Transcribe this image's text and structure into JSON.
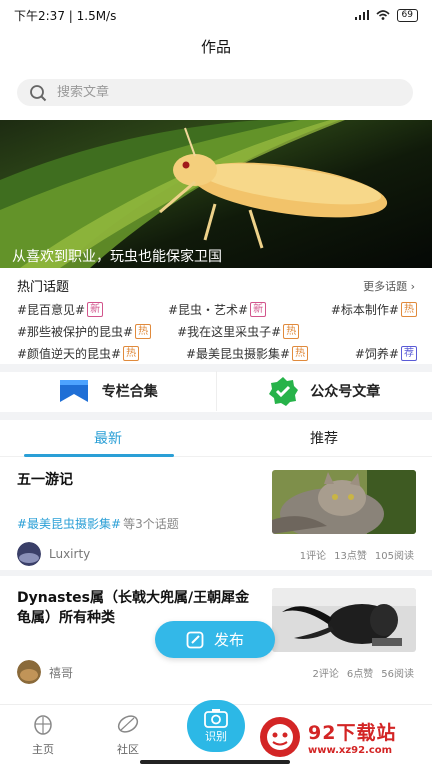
{
  "status": {
    "time_speed": "下午2:37 | 1.5M/s",
    "battery": "69"
  },
  "header": {
    "title": "作品"
  },
  "search": {
    "placeholder": "搜索文章"
  },
  "banner": {
    "caption": "从喜欢到职业，玩虫也能保家卫国"
  },
  "topics": {
    "title": "热门话题",
    "more": "更多话题 ›",
    "rows": [
      [
        {
          "text": "#昆百意见#",
          "tag": "新",
          "kind": "new"
        },
        {
          "text": "#昆虫・艺术#",
          "tag": "新",
          "kind": "new"
        },
        {
          "text": "#标本制作#",
          "tag": "热",
          "kind": "hot"
        }
      ],
      [
        {
          "text": "#那些被保护的昆虫#",
          "tag": "热",
          "kind": "hot"
        },
        {
          "text": "#我在这里采虫子#",
          "tag": "热",
          "kind": "hot"
        }
      ],
      [
        {
          "text": "#颜值逆天的昆虫#",
          "tag": "热",
          "kind": "hot"
        },
        {
          "text": "#最美昆虫摄影集#",
          "tag": "热",
          "kind": "hot"
        },
        {
          "text": "#饲养#",
          "tag": "荐",
          "kind": "rec"
        }
      ]
    ]
  },
  "collections": {
    "column": "专栏合集",
    "wechat": "公众号文章"
  },
  "tabs": {
    "latest": "最新",
    "recommend": "推荐"
  },
  "articles": [
    {
      "title": "五一游记",
      "topic": "#最美昆虫摄影集#",
      "topic_count": "等3个话题",
      "author": "Luxirty",
      "comments": "1评论",
      "likes": "13点赞",
      "reads": "105阅读"
    },
    {
      "title": "Dynastes属（长戟大兜属/王朝犀金龟属）所有种类",
      "author": "禧哥",
      "comments": "2评论",
      "likes": "6点赞",
      "reads": "56阅读"
    }
  ],
  "publish": {
    "label": "发布"
  },
  "nav": {
    "home": "主页",
    "community": "社区",
    "scan": "识别"
  },
  "watermark": {
    "title": "92下载站",
    "url": "www.xz92.com"
  },
  "colors": {
    "accent": "#2a9fd6",
    "publish": "#33b8e8",
    "tag_new": "#d2558c",
    "tag_hot": "#e08a3c",
    "tag_rec": "#5a5bd6"
  }
}
